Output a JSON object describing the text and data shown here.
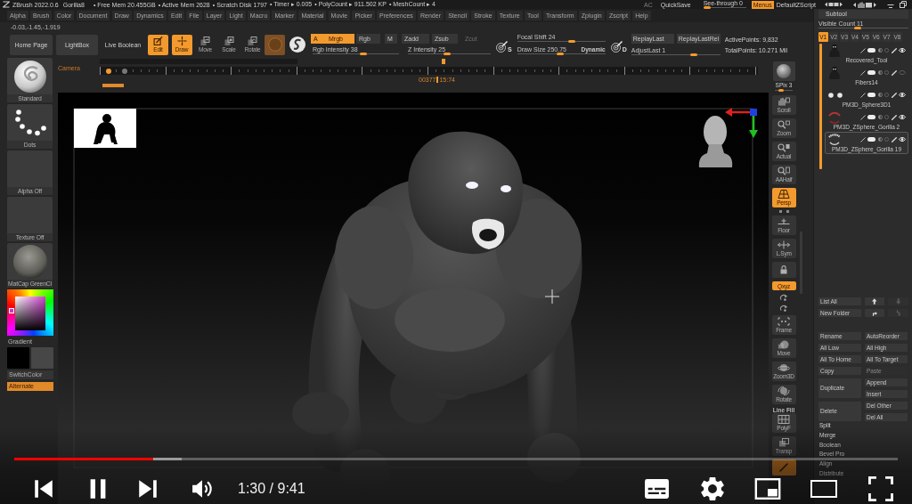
{
  "title_bar": {
    "app": "ZBrush 2022.0.6",
    "document": "Gorilla8",
    "stats": [
      "• Free Mem 20.455GB",
      "• Active Mem 2628",
      "• Scratch Disk 1797",
      "• Timer ▸ 0.005",
      "• PolyCount ▸ 911.502 KP",
      "• MeshCount ▸ 4"
    ],
    "ac": "AC",
    "quick_save": "QuickSave",
    "see_through": {
      "label": "See-through 0",
      "level": 0
    },
    "menus": {
      "label": "Menus",
      "on": true
    },
    "script": "DefaultZScript"
  },
  "menu": [
    "Alpha",
    "Brush",
    "Color",
    "Document",
    "Draw",
    "Dynamics",
    "Edit",
    "File",
    "Layer",
    "Light",
    "Macro",
    "Marker",
    "Material",
    "Movie",
    "Picker",
    "Preferences",
    "Render",
    "Stencil",
    "Stroke",
    "Texture",
    "Tool",
    "Transform",
    "Zplugin",
    "Zscript",
    "Help"
  ],
  "coordinates": "-0.03,-1.45,-1.919",
  "toolbar": {
    "buttons": [
      {
        "kind": "home",
        "label": "Home Page"
      },
      {
        "kind": "lightbox",
        "label": "LightBox"
      }
    ],
    "live_boolean": {
      "label": "Live Boolean",
      "on": false
    },
    "modes": [
      {
        "kind": "edit",
        "label": "Edit",
        "on": true
      },
      {
        "kind": "draw",
        "label": "Draw",
        "on": true
      },
      {
        "kind": "move",
        "label": "Move",
        "on": false
      },
      {
        "kind": "scale",
        "label": "Scale",
        "on": false
      },
      {
        "kind": "rotate",
        "label": "Rotate",
        "on": false
      }
    ],
    "channels": [
      {
        "label": "A",
        "on": true
      },
      {
        "label": "Mrgb",
        "on": true
      },
      {
        "label": "Rgb",
        "on": false
      },
      {
        "label": "M",
        "on": false
      }
    ],
    "depth": [
      {
        "label": "Zadd",
        "on": false,
        "disabled": false
      },
      {
        "label": "Zsub",
        "on": false,
        "disabled": false
      },
      {
        "label": "Zcut",
        "on": false,
        "disabled": true
      }
    ],
    "rgb_intensity": {
      "label": "Rgb Intensity 38",
      "level": 0.6
    },
    "z_intensity": {
      "label": "Z Intensity 25",
      "level": 0.47
    },
    "focal_badge": "S",
    "focal_shift": {
      "label": "Focal Shift 24",
      "level": 0.63
    },
    "draw_size": {
      "label": "Draw Size 250.75",
      "level": 0.49
    },
    "dynamic": "Dynamic",
    "replay_badge": "D",
    "replay": [
      "ReplayLast",
      "ReplayLastRel"
    ],
    "adjust_last": {
      "label": "AdjustLast 1",
      "level": 0.72
    },
    "points": [
      "ActivePoints: 9,832",
      "TotalPoints: 10.271 Mil"
    ]
  },
  "left_panel": {
    "tiles": [
      {
        "kind": "brush",
        "label": "Standard"
      },
      {
        "kind": "stroke",
        "label": "Dots"
      },
      {
        "kind": "alpha",
        "label": "Alpha Off"
      },
      {
        "kind": "texture",
        "label": "Texture Off"
      },
      {
        "kind": "material",
        "label": "MatCap GreenCl"
      }
    ],
    "gradient": "Gradient",
    "swatches": [
      {
        "color": "#000000"
      },
      {
        "color": "#474747"
      }
    ],
    "switch_color": "SwitchColor",
    "alternate": {
      "label": "Alternate",
      "on": true
    }
  },
  "timeline": {
    "label": "Camera",
    "keyframes": [
      {
        "selected": true
      },
      {
        "selected": false
      }
    ],
    "frame": "00377",
    "time": "15:74"
  },
  "shelf": {
    "spix": {
      "label": "SPix 3",
      "level": 0.3
    },
    "buttons": [
      {
        "kind": "scroll",
        "label": "Scroll",
        "on": false
      },
      {
        "kind": "zoom",
        "label": "Zoom",
        "on": false
      },
      {
        "kind": "actual",
        "label": "Actual",
        "on": false
      },
      {
        "kind": "aahalf",
        "label": "AAHalf",
        "on": false
      },
      {
        "kind": "persp",
        "label": "Persp",
        "on": true
      },
      {
        "kind": "floor",
        "label": "Floor",
        "on": false
      },
      {
        "kind": "lsym",
        "label": "L.Sym",
        "on": false
      },
      {
        "kind": "lock",
        "on": false
      },
      {
        "kind": "xyz",
        "label": "Qxyz",
        "on": true
      },
      {
        "kind": "axis",
        "on": false
      },
      {
        "kind": "axis",
        "on": false
      },
      {
        "kind": "frame",
        "label": "Frame",
        "on": false
      },
      {
        "kind": "move",
        "label": "Move",
        "on": false
      },
      {
        "kind": "zoom3d",
        "label": "Zoom3D",
        "on": false
      },
      {
        "kind": "rotate",
        "label": "Rotate",
        "on": false
      },
      {
        "kind": "polyf",
        "caption": "Line Fill",
        "label": "PolyF",
        "on": false
      },
      {
        "kind": "transp",
        "label": "Transp",
        "on": false
      },
      {
        "kind": "ghost",
        "on": true
      }
    ]
  },
  "subtool": {
    "title": "Subtool",
    "visible_count": {
      "label": "Visible Count 11",
      "level": 0.43
    },
    "versions": [
      {
        "label": "V1",
        "selected": true
      },
      {
        "label": "V2",
        "selected": false
      },
      {
        "label": "V3",
        "selected": false
      },
      {
        "label": "V4",
        "selected": false
      },
      {
        "label": "V5",
        "selected": false
      },
      {
        "label": "V6",
        "selected": false
      },
      {
        "label": "V7",
        "selected": false
      },
      {
        "label": "V8",
        "selected": false
      }
    ],
    "items": [
      {
        "name": "Recovered_Tool",
        "kind": "creature",
        "visible": true,
        "selected": false
      },
      {
        "name": "Fibers14",
        "kind": "creature",
        "visible": false,
        "selected": false
      },
      {
        "name": "PM3D_Sphere3D1",
        "kind": "dots",
        "visible": true,
        "selected": false
      },
      {
        "name": "PM3D_ZSphere_Gorilla 2",
        "kind": "jaw",
        "visible": true,
        "selected": false
      },
      {
        "name": "PM3D_ZSphere_Gorilla 19",
        "kind": "teeth",
        "visible": true,
        "selected": true
      }
    ],
    "list_all": "List All",
    "move_arrows": [
      {
        "kind": "up",
        "disabled": false
      },
      {
        "kind": "down",
        "disabled": true
      }
    ],
    "new_folder": "New Folder",
    "folder_arrows": [
      {
        "kind": "in",
        "disabled": false
      },
      {
        "kind": "out",
        "disabled": true
      }
    ],
    "action_rows": [
      [
        {
          "label": "Rename",
          "disabled": false
        },
        {
          "label": "AutoReorder",
          "disabled": false
        }
      ],
      [
        {
          "label": "All Low",
          "disabled": false
        },
        {
          "label": "All High",
          "disabled": false
        }
      ],
      [
        {
          "label": "All To Home",
          "disabled": false
        },
        {
          "label": "All To Target",
          "disabled": false
        }
      ],
      [
        {
          "label": "Copy",
          "disabled": false
        },
        {
          "label": "Paste",
          "disabled": true
        }
      ]
    ],
    "action_groups": [
      {
        "label": "Duplicate",
        "disabled": false,
        "options": [
          {
            "label": "Append",
            "disabled": false
          },
          {
            "label": "Insert",
            "disabled": false
          }
        ]
      },
      {
        "label": "Delete",
        "disabled": false,
        "options": [
          {
            "label": "Del Other",
            "disabled": false
          },
          {
            "label": "Del All",
            "disabled": false
          }
        ]
      }
    ],
    "tools": [
      "Split",
      "Merge",
      "Boolean",
      "Bevel Pro",
      "Align",
      "Distribute"
    ]
  },
  "player": {
    "playing": true,
    "progress": {
      "played": {
        "level": 0.157
      },
      "loaded": {
        "level": 0.19
      }
    },
    "time": "1:30 / 9:41"
  }
}
